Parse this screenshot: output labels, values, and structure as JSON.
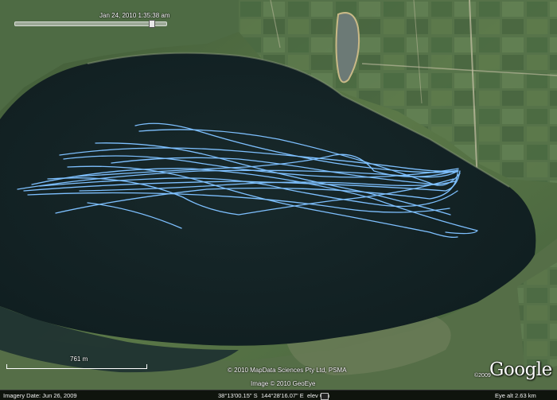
{
  "timeline": {
    "timestamp": "Jan 24, 2010   1:35:38 am",
    "slider_position": 0.93
  },
  "scale": {
    "label": "761 m"
  },
  "attribution": {
    "line1": "© 2010 MapData Sciences Pty Ltd, PSMA",
    "line2": "Image © 2010 GeoEye",
    "line3": "©2009",
    "logo_text": "Google"
  },
  "status_bar": {
    "imagery_date": "Imagery Date: Jun 26, 2009",
    "latitude": "38°13'00.15\" S",
    "longitude": "144°28'16.07\" E",
    "elevation_label": "elev    0 m",
    "eye_alt": "Eye alt    2.63 km"
  },
  "colors": {
    "track": "#7ec0ff",
    "water": "#142425",
    "land": "#4d6a42"
  },
  "icons": {
    "stream": "streaming-indicator-icon"
  }
}
